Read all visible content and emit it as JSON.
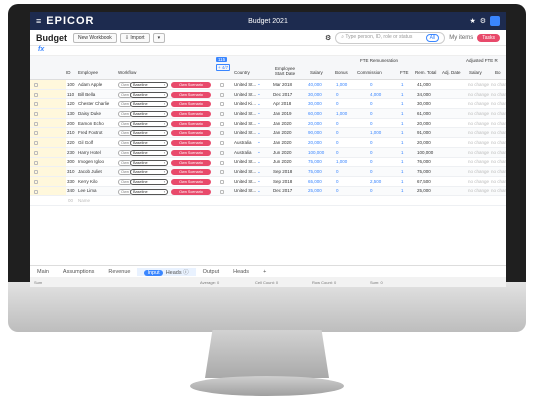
{
  "app": {
    "brand": "EPICOR",
    "window_title": "Budget 2021"
  },
  "toolbar": {
    "title": "Budget",
    "new_workbook": "New Workbook",
    "import": "Import",
    "search_placeholder": "Type person, ID, role or status",
    "search_scope": "All",
    "my_items": "My items",
    "tasks": "Tasks"
  },
  "formula": {
    "fx": "fx"
  },
  "grid": {
    "headers": {
      "id": "ID",
      "employee": "Employee",
      "workflow": "Workflow",
      "country": "Country",
      "start_date": "Employee Start Date",
      "fte_group": "FTE Remuneration",
      "salary": "Salary",
      "bonus": "Bonus",
      "commission": "Commission",
      "fte": "FTE",
      "rem_total": "Rem. Total",
      "adjusted": "Adjusted FTE R",
      "adj_date": "Adj. Date",
      "adj_salary": "Salary",
      "adj_bo": "Bo",
      "col_tag1": "115",
      "col_tag2": "+ 4/7"
    },
    "workflow_labels": {
      "state": "Baseline",
      "action": "Own Scenario"
    },
    "adjust_placeholders": {
      "a": "no change",
      "b": "no chan"
    },
    "rows": [
      {
        "id": "100",
        "name": "Adam Apple",
        "country": "United St...",
        "date": "Mar 2018",
        "salary": "40,000",
        "bonus": "1,000",
        "commission": "0",
        "fte": "1",
        "total": "41,000"
      },
      {
        "id": "110",
        "name": "Bill Bella",
        "country": "United St...",
        "date": "Dec 2017",
        "salary": "30,000",
        "bonus": "0",
        "commission": "4,000",
        "fte": "1",
        "total": "34,000"
      },
      {
        "id": "120",
        "name": "Chester Charlie",
        "country": "United Ki...",
        "date": "Apr 2018",
        "salary": "30,000",
        "bonus": "0",
        "commission": "0",
        "fte": "1",
        "total": "30,000"
      },
      {
        "id": "130",
        "name": "Daisy Duke",
        "country": "United St...",
        "date": "Jan 2019",
        "salary": "60,000",
        "bonus": "1,000",
        "commission": "0",
        "fte": "1",
        "total": "61,000"
      },
      {
        "id": "200",
        "name": "Eamon Echo",
        "country": "United St...",
        "date": "Jan 2020",
        "salary": "20,000",
        "bonus": "0",
        "commission": "0",
        "fte": "1",
        "total": "20,000"
      },
      {
        "id": "210",
        "name": "Fred Foxtrot",
        "country": "United St...",
        "date": "Jan 2020",
        "salary": "90,000",
        "bonus": "0",
        "commission": "1,000",
        "fte": "1",
        "total": "91,000"
      },
      {
        "id": "220",
        "name": "Gil Golf",
        "country": "Australia",
        "date": "Jan 2020",
        "salary": "20,000",
        "bonus": "0",
        "commission": "0",
        "fte": "1",
        "total": "20,000"
      },
      {
        "id": "230",
        "name": "Harry Hotel",
        "country": "Australia",
        "date": "Jun 2020",
        "salary": "100,000",
        "bonus": "0",
        "commission": "0",
        "fte": "1",
        "total": "100,000"
      },
      {
        "id": "300",
        "name": "Imogen Igloo",
        "country": "United St...",
        "date": "Jun 2020",
        "salary": "75,000",
        "bonus": "1,000",
        "commission": "0",
        "fte": "1",
        "total": "76,000"
      },
      {
        "id": "310",
        "name": "Jacob Juliet",
        "country": "United St...",
        "date": "Sep 2018",
        "salary": "75,000",
        "bonus": "0",
        "commission": "0",
        "fte": "1",
        "total": "75,000"
      },
      {
        "id": "330",
        "name": "Kerry Kilo",
        "country": "United St...",
        "date": "Sep 2018",
        "salary": "65,000",
        "bonus": "0",
        "commission": "2,500",
        "fte": "1",
        "total": "67,500"
      },
      {
        "id": "340",
        "name": "Lee Lima",
        "country": "United St...",
        "date": "Dec 2017",
        "salary": "25,000",
        "bonus": "0",
        "commission": "0",
        "fte": "1",
        "total": "25,000"
      }
    ],
    "new_row": {
      "id": "00",
      "name": "Name"
    }
  },
  "tabs": [
    {
      "label": "Main"
    },
    {
      "label": "Assumptions"
    },
    {
      "label": "Revenue"
    },
    {
      "label": "Heads",
      "badge": "Input",
      "active": true
    },
    {
      "label": "Output"
    },
    {
      "label": "Heads"
    },
    {
      "label": "+"
    }
  ],
  "status": {
    "left": "Sum",
    "avg": "Average: 0",
    "cell": "Cell Count: 0",
    "row": "Row Count: 0",
    "sum": "Sum: 0"
  }
}
